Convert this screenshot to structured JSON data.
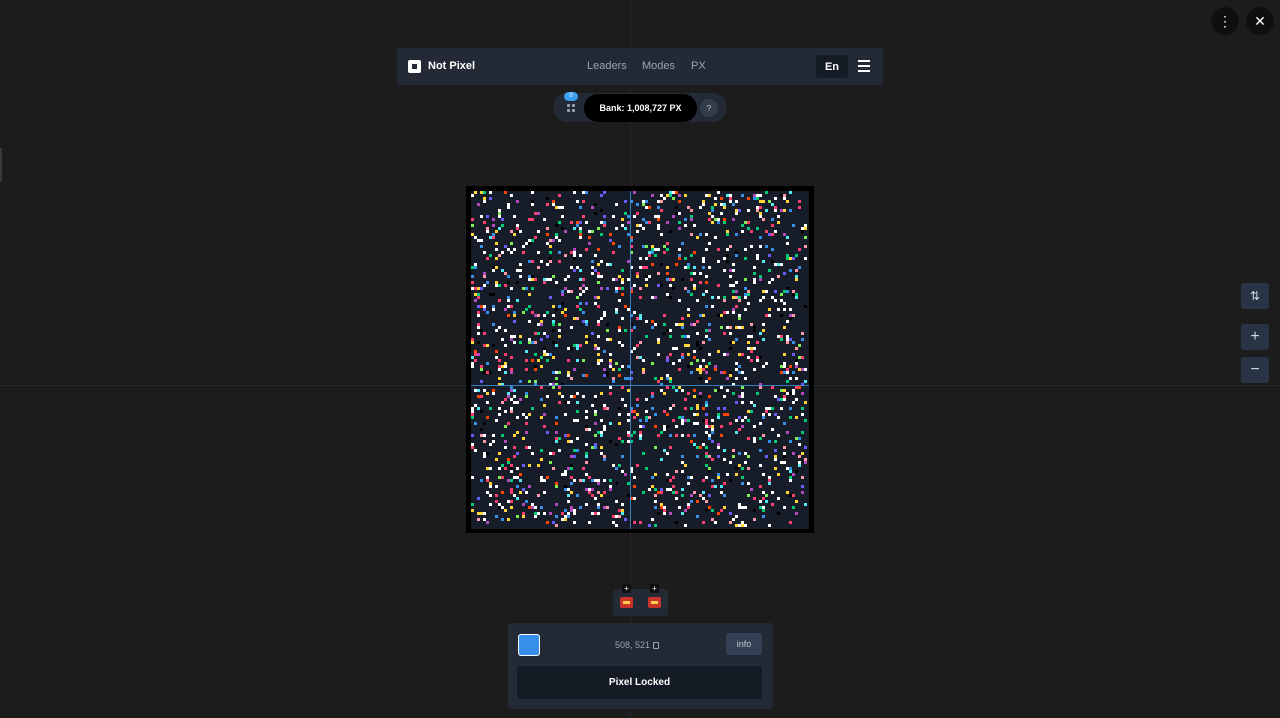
{
  "window_controls": {
    "more_icon": "vertical-dots-icon",
    "close_icon": "close-icon",
    "more_glyph": "⋮",
    "close_glyph": "✕"
  },
  "navbar": {
    "brand": "Not Pixel",
    "links": [
      "Leaders",
      "Modes",
      "PX"
    ],
    "language": "En"
  },
  "bank": {
    "badge_count": "0",
    "label": "Bank: 1,008,727 PX",
    "help": "?"
  },
  "canvas": {
    "background_color": "#161d29",
    "palette": [
      "#ffffff",
      "#ff3d6e",
      "#ffd635",
      "#3690ea",
      "#00cc78",
      "#b44ac0",
      "#ff99aa",
      "#51e9f4",
      "#6a5cff",
      "#ff4500",
      "#000000",
      "#7eed56"
    ]
  },
  "zoom_controls": {
    "adjust_icon": "sort-arrows-icon",
    "zoom_in": "+",
    "zoom_out": "−"
  },
  "boosters": {
    "plus": "+"
  },
  "pixel_panel": {
    "selected_color": "#3690ea",
    "coordinates": "508, 521",
    "info_label": "info",
    "status": "Pixel Locked"
  }
}
